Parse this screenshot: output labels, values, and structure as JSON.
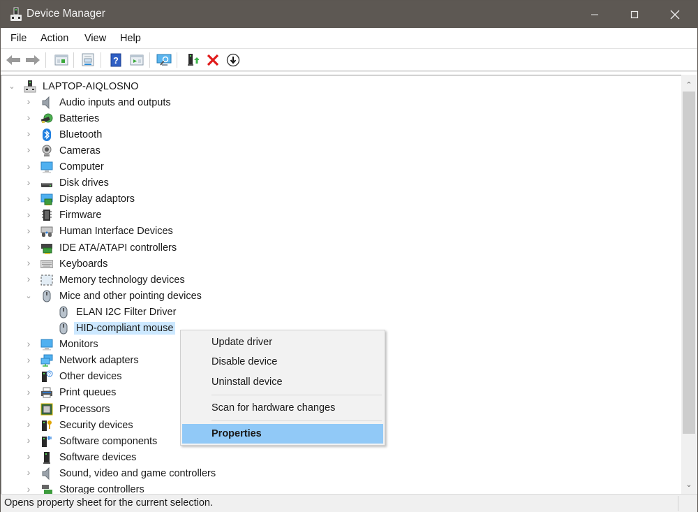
{
  "window": {
    "title": "Device Manager",
    "controls": {
      "minimize": "minimize",
      "maximize": "maximize",
      "close": "close"
    }
  },
  "menubar": {
    "items": [
      "File",
      "Action",
      "View",
      "Help"
    ]
  },
  "toolbar": {
    "buttons": [
      {
        "name": "back",
        "icon": "back-arrow-icon"
      },
      {
        "name": "forward",
        "icon": "forward-arrow-icon"
      },
      {
        "name": "show-hide-console-tree",
        "icon": "console-tree-icon"
      },
      {
        "name": "properties",
        "icon": "properties-sheet-icon"
      },
      {
        "name": "help",
        "icon": "help-icon"
      },
      {
        "name": "show-action-pane",
        "icon": "action-pane-icon"
      },
      {
        "name": "scan-hardware",
        "icon": "scan-monitor-icon"
      },
      {
        "name": "update-driver",
        "icon": "update-driver-icon"
      },
      {
        "name": "uninstall",
        "icon": "red-x-icon"
      },
      {
        "name": "disable",
        "icon": "down-arrow-circle-icon"
      }
    ]
  },
  "tree": {
    "root": {
      "label": "LAPTOP-AIQLOSNO",
      "expanded": true,
      "icon": "computer-tower-icon"
    },
    "categories": [
      {
        "label": "Audio inputs and outputs",
        "icon": "speaker-icon",
        "expanded": false
      },
      {
        "label": "Batteries",
        "icon": "battery-icon",
        "expanded": false
      },
      {
        "label": "Bluetooth",
        "icon": "bluetooth-icon",
        "expanded": false
      },
      {
        "label": "Cameras",
        "icon": "webcam-icon",
        "expanded": false
      },
      {
        "label": "Computer",
        "icon": "monitor-icon",
        "expanded": false
      },
      {
        "label": "Disk drives",
        "icon": "disk-drive-icon",
        "expanded": false
      },
      {
        "label": "Display adaptors",
        "icon": "display-adapter-icon",
        "expanded": false
      },
      {
        "label": "Firmware",
        "icon": "firmware-chip-icon",
        "expanded": false
      },
      {
        "label": "Human Interface Devices",
        "icon": "hid-icon",
        "expanded": false
      },
      {
        "label": "IDE ATA/ATAPI controllers",
        "icon": "ide-controller-icon",
        "expanded": false
      },
      {
        "label": "Keyboards",
        "icon": "keyboard-icon",
        "expanded": false
      },
      {
        "label": "Memory technology devices",
        "icon": "memory-card-icon",
        "expanded": false
      },
      {
        "label": "Mice and other pointing devices",
        "icon": "mouse-icon",
        "expanded": true,
        "children": [
          {
            "label": "ELAN I2C Filter Driver",
            "icon": "mouse-icon",
            "selected": false
          },
          {
            "label": "HID-compliant mouse",
            "icon": "mouse-icon",
            "selected": true
          }
        ]
      },
      {
        "label": "Monitors",
        "icon": "monitor-icon",
        "expanded": false
      },
      {
        "label": "Network adapters",
        "icon": "network-icon",
        "expanded": false
      },
      {
        "label": "Other devices",
        "icon": "unknown-device-icon",
        "expanded": false
      },
      {
        "label": "Print queues",
        "icon": "printer-icon",
        "expanded": false
      },
      {
        "label": "Processors",
        "icon": "processor-icon",
        "expanded": false
      },
      {
        "label": "Security devices",
        "icon": "security-key-icon",
        "expanded": false
      },
      {
        "label": "Software components",
        "icon": "software-component-icon",
        "expanded": false
      },
      {
        "label": "Software devices",
        "icon": "software-device-icon",
        "expanded": false
      },
      {
        "label": "Sound, video and game controllers",
        "icon": "speaker-icon",
        "expanded": false
      },
      {
        "label": "Storage controllers",
        "icon": "storage-controller-icon",
        "expanded": false
      }
    ]
  },
  "context_menu": {
    "items": [
      {
        "label": "Update driver",
        "highlighted": false,
        "bold": false
      },
      {
        "label": "Disable device",
        "highlighted": false,
        "bold": false
      },
      {
        "label": "Uninstall device",
        "highlighted": false,
        "bold": false
      },
      {
        "separator": true
      },
      {
        "label": "Scan for hardware changes",
        "highlighted": false,
        "bold": false
      },
      {
        "separator": true
      },
      {
        "label": "Properties",
        "highlighted": true,
        "bold": true
      }
    ]
  },
  "statusbar": {
    "text": "Opens property sheet for the current selection."
  },
  "colors": {
    "titlebar": "#5d5853",
    "selection": "#cce8ff",
    "menu_highlight": "#91c9f7",
    "context_menu_bg": "#f2f2f2"
  }
}
